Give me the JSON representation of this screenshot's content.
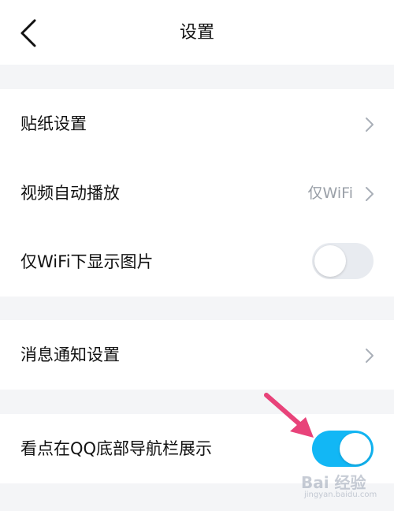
{
  "header": {
    "title": "设置",
    "back_icon": "chevron-left-icon"
  },
  "sections": [
    {
      "rows": [
        {
          "label": "贴纸设置",
          "control": "chevron"
        },
        {
          "label": "视频自动播放",
          "value": "仅WiFi",
          "control": "chevron"
        },
        {
          "label": "仅WiFi下显示图片",
          "control": "toggle",
          "toggle_on": false
        }
      ]
    },
    {
      "rows": [
        {
          "label": "消息通知设置",
          "control": "chevron"
        }
      ]
    },
    {
      "rows": [
        {
          "label": "看点在QQ底部导航栏展示",
          "control": "toggle",
          "toggle_on": true
        }
      ]
    }
  ],
  "colors": {
    "background": "#f4f5f7",
    "card": "#ffffff",
    "toggle_on": "#12b7f5",
    "toggle_off": "#e8ebf0",
    "annotation_arrow": "#e8437a"
  },
  "annotation": {
    "arrow_icon": "pink-arrow-icon"
  },
  "watermark": {
    "main": "Bai 经验",
    "sub": "jingyan.baidu.com"
  }
}
